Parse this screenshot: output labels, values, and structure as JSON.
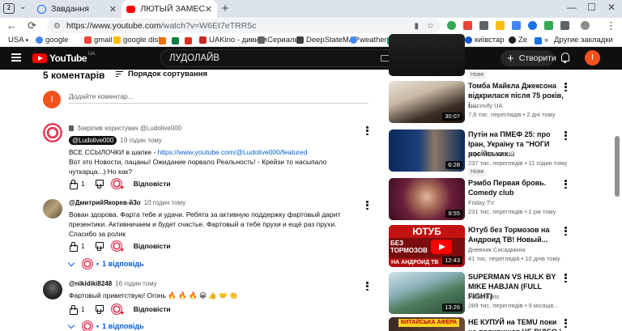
{
  "browser": {
    "tab_count": "2",
    "tabs": [
      {
        "label": "Завдання",
        "active": false
      },
      {
        "label": "ЛЮТЫЙ ЗАМЕС В КРЕ",
        "active": true
      }
    ],
    "url_host": "https://www.youtube.com",
    "url_path": "/watch?v=W6Et7eTRR5c",
    "bookmarks": [
      "USA",
      "google",
      "gmail",
      "google disk",
      "UAKino - дивити",
      "Сериалы",
      "DeepStateMAP",
      "weather",
      "київстар",
      "Ze",
      "Другие закладки"
    ]
  },
  "youtube": {
    "logo_text": "YouTube",
    "country_code": "UA",
    "search_value": "ЛУДОЛАЙВ",
    "create_label": "Створити",
    "user_initial": "I"
  },
  "comments": {
    "title": "5 коментарів",
    "sort_label": "Порядок сортування",
    "add_placeholder": "Додайте коментар...",
    "user_initial": "I",
    "items": [
      {
        "pinned_by": "Закріпив користувач @Ludolive000",
        "author": "@Ludolive000",
        "time": "19 годин тому",
        "text_pre": "ВСЕ ССЫЛОЧКИ в шапке - ",
        "link": "https://www.youtube.com/@Ludolive000/featured",
        "text_post": "Вот это Новости, пацаны! Ожидание порвало Реальность! - Крейзи то насыпало чуткарца...) Но как?",
        "likes": "1",
        "reply_label": "Відповісти"
      },
      {
        "author": "@ДмитрийЯкорев-й3о",
        "time": "10 годин тому",
        "text": "Вован здорова. Фарта тебе и удачи. Ребята за активную поддержку фартовый дарит презентики. Активничаем и будет счастье. Фартовый а тебе прухи и ещё раз прухи. Спасибо за ролик",
        "likes": "1",
        "reply_label": "Відповісти",
        "replies": "1 відповідь"
      },
      {
        "author": "@nikidiki8248",
        "time": "16 годин тому",
        "text": "Фартовый приветствую! Огонь 🔥 🔥 🔥 😀 👍 🤝 👏",
        "likes": "1",
        "reply_label": "Відповісти",
        "replies": "1 відповідь"
      }
    ]
  },
  "sidebar": {
    "top_badge": "Нове",
    "videos": [
      {
        "title": "Томба Майкла Джексона відкрилася після 75 років, і...",
        "channel": "Discovify UA",
        "meta": "7,6 тис. переглядів  •  2 дні тому",
        "duration": "30:07",
        "badge": ""
      },
      {
        "title": "Путін на ПМЕФ 25: про Іран, Україну та \"НОГИ російських...",
        "channel": "Юрий ВЕЛИКИЙ",
        "meta": "237 тис. переглядів  •  11 годин тому",
        "duration": "6:28",
        "badge": "Нове"
      },
      {
        "title": "Рэмбо Первая бровь. Comedy club",
        "channel": "Friday TV",
        "meta": "231 тис. переглядів  •  1 рік тому",
        "duration": "9:55",
        "badge": ""
      },
      {
        "title": "Ютуб без Тормозов на Андроид ТВ! Новый...",
        "channel": "Дневник Сисадмина",
        "meta": "41 тис. переглядів  •  10 днів тому",
        "duration": "12:43",
        "badge": "",
        "thumb_text_top": "ЮТУБ",
        "thumb_text_mid": "БЕЗ ТОРМОЗОВ",
        "thumb_text_bot": "НА АНДРОИД ТВ"
      },
      {
        "title": "SUPERMAN VS HULK BY MIKE HABJAN (FULL FIGHT)",
        "channel": "Vader Edits",
        "meta": "289 тис. переглядів  •  9 місяців...",
        "duration": "13:26",
        "badge": ""
      },
      {
        "title": "НЕ КУПУЙ на TEMU поки не подивишся ЦЕ ВІДЕО |",
        "channel": "",
        "meta": "",
        "duration": "",
        "badge": "",
        "thumb_text_top": "КИТАЙСЬКА АФЕРА"
      }
    ]
  },
  "colors": {
    "yt_red": "#ff0000",
    "header_bg": "#0f0f0f",
    "link_blue": "#065fd4",
    "avatar_orange": "#f4511e"
  }
}
